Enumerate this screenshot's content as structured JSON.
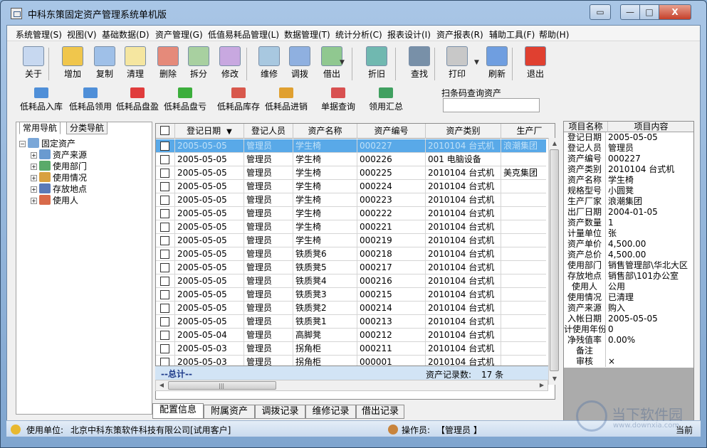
{
  "window": {
    "title": "中科东策固定资产管理系统单机版",
    "close_symbol": "X",
    "min_symbol": "—",
    "max_symbol": "□",
    "aux_symbol": "▭"
  },
  "menu": [
    "系统管理(S)",
    "视图(V)",
    "基础数据(D)",
    "资产管理(G)",
    "低值易耗品管理(L)",
    "数据管理(T)",
    "统计分析(C)",
    "报表设计(I)",
    "资产报表(R)",
    "辅助工具(F)",
    "帮助(H)"
  ],
  "toolbar1": [
    {
      "label": "关于",
      "icon": "about-card-icon",
      "color": "#c7d8f0"
    },
    {
      "label": "增加",
      "icon": "add-database-icon",
      "color": "#f0c64c"
    },
    {
      "label": "复制",
      "icon": "copy-grid-icon",
      "color": "#9fc0e8"
    },
    {
      "label": "清理",
      "icon": "clean-grid-icon",
      "color": "#f5e6a0"
    },
    {
      "label": "删除",
      "icon": "delete-icon",
      "color": "#e58a7a"
    },
    {
      "label": "拆分",
      "icon": "split-icon",
      "color": "#a8d0a0"
    },
    {
      "label": "修改",
      "icon": "edit-icon",
      "color": "#c8a8e0"
    },
    {
      "label": "维修",
      "icon": "repair-icon",
      "color": "#a8c8e0"
    },
    {
      "label": "调拨",
      "icon": "transfer-icon",
      "color": "#8fb0e0"
    },
    {
      "label": "借出",
      "icon": "lend-icon",
      "color": "#90c890"
    },
    {
      "label": "折旧",
      "icon": "depreciation-icon",
      "color": "#70b8b0"
    },
    {
      "label": "查找",
      "icon": "binoculars-icon",
      "color": "#7890a8"
    },
    {
      "label": "打印",
      "icon": "printer-icon",
      "color": "#c8c8c8"
    },
    {
      "label": "刷新",
      "icon": "refresh-icon",
      "color": "#6f9ee0"
    },
    {
      "label": "退出",
      "icon": "power-icon",
      "color": "#e04030"
    }
  ],
  "toolbar2": [
    {
      "label": "低耗品入库",
      "icon": "stock-in-icon",
      "color": "#4f8fd8"
    },
    {
      "label": "低耗品领用",
      "icon": "receive-icon",
      "color": "#4f8fd8"
    },
    {
      "label": "低耗品盘盈",
      "icon": "profit-funnel-icon",
      "color": "#e03c3c"
    },
    {
      "label": "低耗品盘亏",
      "icon": "loss-funnel-icon",
      "color": "#3cae3c"
    },
    {
      "label": "低耗品库存",
      "icon": "inventory-icon",
      "color": "#d8584c"
    },
    {
      "label": "低耗品进销",
      "icon": "purchase-sale-icon",
      "color": "#e0a030"
    },
    {
      "label": "单据查询",
      "icon": "document-query-icon",
      "color": "#d85050"
    },
    {
      "label": "领用汇总",
      "icon": "summary-icon",
      "color": "#40a060"
    }
  ],
  "scan": {
    "label": "扫条码查询资产",
    "placeholder": ""
  },
  "nav": {
    "tabs": [
      "常用导航",
      "分类导航"
    ],
    "root": "固定资产",
    "children": [
      "资产来源",
      "使用部门",
      "使用情况",
      "存放地点",
      "使用人"
    ]
  },
  "grid": {
    "columns": [
      "登记日期",
      "登记人员",
      "资产名称",
      "资产编号",
      "资产类别",
      "生产厂"
    ],
    "sort_indicator": "▼",
    "rows": [
      [
        "2005-05-05",
        "管理员",
        "学生椅",
        "000227",
        "2010104 台式机",
        "浪潮集团"
      ],
      [
        "2005-05-05",
        "管理员",
        "学生椅",
        "000226",
        "001 电脑设备",
        ""
      ],
      [
        "2005-05-05",
        "管理员",
        "学生椅",
        "000225",
        "2010104 台式机",
        "美克集团"
      ],
      [
        "2005-05-05",
        "管理员",
        "学生椅",
        "000224",
        "2010104 台式机",
        ""
      ],
      [
        "2005-05-05",
        "管理员",
        "学生椅",
        "000223",
        "2010104 台式机",
        ""
      ],
      [
        "2005-05-05",
        "管理员",
        "学生椅",
        "000222",
        "2010104 台式机",
        ""
      ],
      [
        "2005-05-05",
        "管理员",
        "学生椅",
        "000221",
        "2010104 台式机",
        ""
      ],
      [
        "2005-05-05",
        "管理员",
        "学生椅",
        "000219",
        "2010104 台式机",
        ""
      ],
      [
        "2005-05-05",
        "管理员",
        "铁质凳6",
        "000218",
        "2010104 台式机",
        ""
      ],
      [
        "2005-05-05",
        "管理员",
        "铁质凳5",
        "000217",
        "2010104 台式机",
        ""
      ],
      [
        "2005-05-05",
        "管理员",
        "铁质凳4",
        "000216",
        "2010104 台式机",
        ""
      ],
      [
        "2005-05-05",
        "管理员",
        "铁质凳3",
        "000215",
        "2010104 台式机",
        ""
      ],
      [
        "2005-05-05",
        "管理员",
        "铁质凳2",
        "000214",
        "2010104 台式机",
        ""
      ],
      [
        "2005-05-05",
        "管理员",
        "铁质凳1",
        "000213",
        "2010104 台式机",
        ""
      ],
      [
        "2005-05-04",
        "管理员",
        "高脚凳",
        "000212",
        "2010104 台式机",
        ""
      ],
      [
        "2005-05-03",
        "管理员",
        "拐角柜",
        "000211",
        "2010104 台式机",
        ""
      ],
      [
        "2005-05-03",
        "管理员",
        "拐角柜",
        "000001",
        "2010104 台式机",
        ""
      ]
    ],
    "selected_row": 0,
    "footer": {
      "total_label": "--总计--",
      "count_label": "资产记录数:",
      "count": "17 条"
    }
  },
  "bottom_tabs": [
    "配置信息",
    "附属资产",
    "调拨记录",
    "维修记录",
    "借出记录"
  ],
  "detail": {
    "headers": [
      "项目名称",
      "项目内容"
    ],
    "rows": [
      [
        "登记日期",
        "2005-05-05"
      ],
      [
        "登记人员",
        "管理员"
      ],
      [
        "资产编号",
        "000227"
      ],
      [
        "资产类别",
        "2010104 台式机"
      ],
      [
        "资产名称",
        "学生椅"
      ],
      [
        "规格型号",
        "小圆凳"
      ],
      [
        "生产厂家",
        "浪潮集团"
      ],
      [
        "出厂日期",
        "2004-01-05"
      ],
      [
        "资产数量",
        "1"
      ],
      [
        "计量单位",
        "张"
      ],
      [
        "资产单价",
        "4,500.00"
      ],
      [
        "资产总价",
        "4,500.00"
      ],
      [
        "使用部门",
        "销售管理部\\华北大区"
      ],
      [
        "存放地点",
        "销售部\\101办公室"
      ],
      [
        "使用人",
        "公用"
      ],
      [
        "使用情况",
        "已清理"
      ],
      [
        "资产来源",
        "购入"
      ],
      [
        "入帐日期",
        "2005-05-05"
      ],
      [
        "计使用年份",
        "0"
      ],
      [
        "净残值率",
        "0.00%"
      ],
      [
        "备注",
        ""
      ],
      [
        "审核",
        "×"
      ]
    ]
  },
  "status": {
    "unit_label": "使用单位:",
    "unit": "北京中科东策软件科技有限公司[试用客户]",
    "operator_label": "操作员:",
    "operator": "【管理员 】",
    "tail": "当前"
  },
  "watermark": {
    "text": "当下软件园",
    "url": "www.downxia.com"
  }
}
